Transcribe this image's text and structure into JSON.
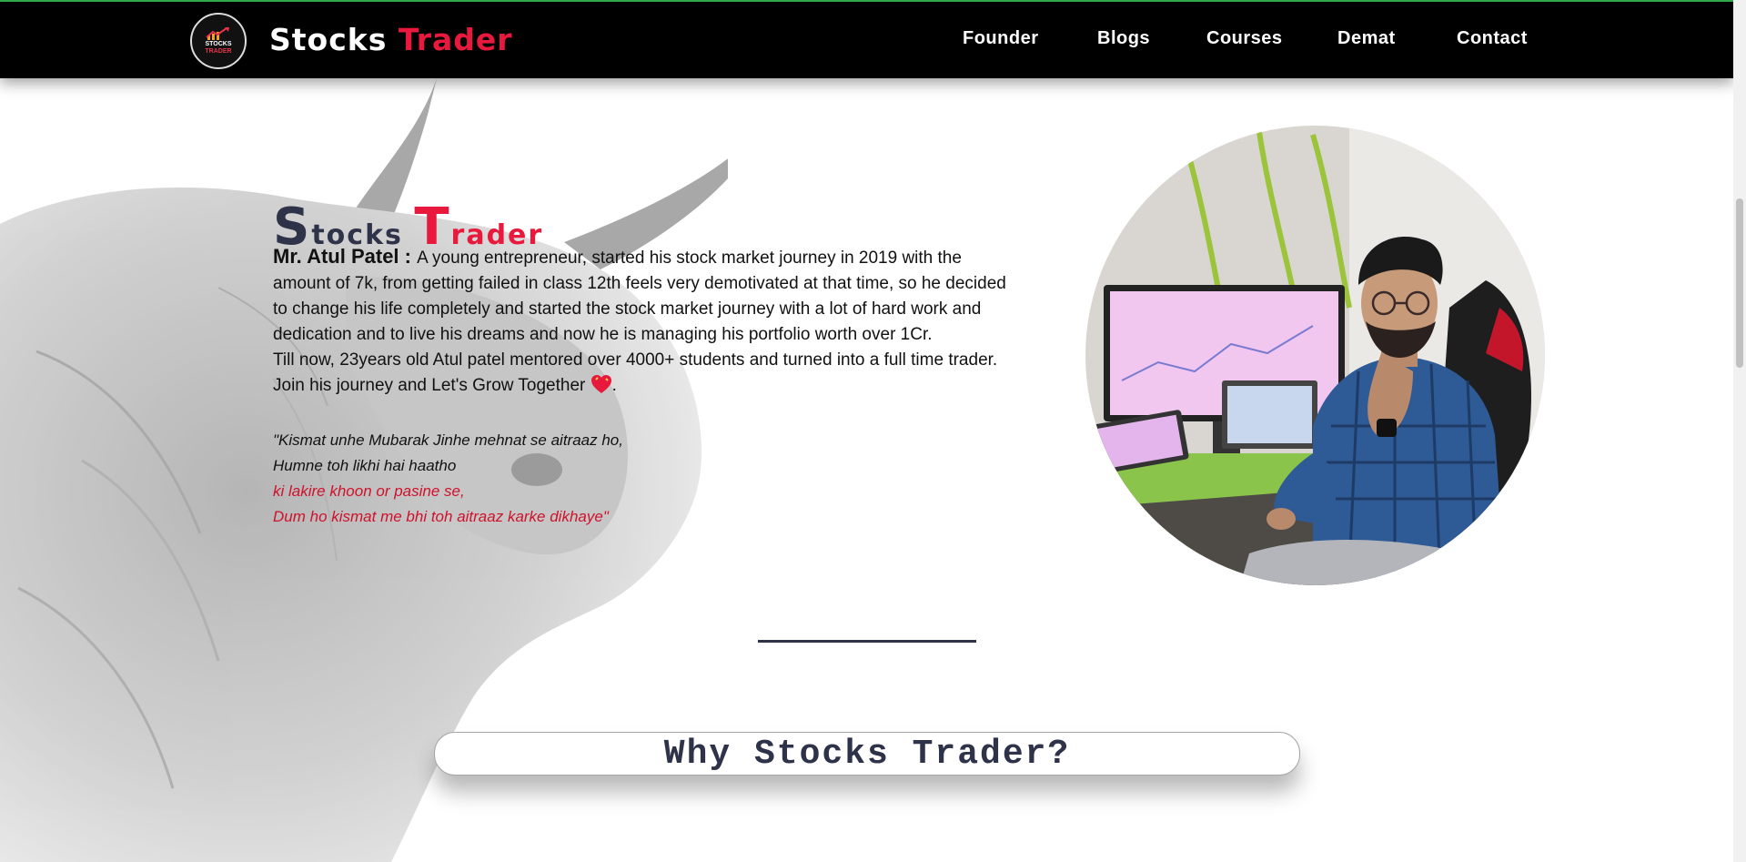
{
  "navbar": {
    "logo": {
      "line1": "STOCKS",
      "line2": "TRADER"
    },
    "brand": {
      "first_initial": "S",
      "first_rest": "tocks ",
      "second_initial": "T",
      "second_rest": "rader"
    },
    "links": [
      "Founder",
      "Blogs",
      "Courses",
      "Demat",
      "Contact"
    ]
  },
  "hero": {
    "title": {
      "first_initial": "S",
      "first_rest": "tocks ",
      "second_initial": "T",
      "second_rest": "rader"
    },
    "founder_label": "Mr. Atul Patel : ",
    "bio_line1": "A young entrepreneur, started his stock market journey in 2019 with the amount of 7k, from getting failed in class 12th feels very demotivated at that time, so he decided to change his life completely and started the stock market journey with a lot of hard work and dedication and to live his dreams and now he is managing his portfolio worth over 1Cr.",
    "bio_line2": "Till now, 23years old Atul patel mentored over 4000+ students and turned into a full time trader.",
    "bio_line3": "Join his journey and Let's Grow Together",
    "bio_line3_end": ".",
    "quote": [
      "\"Kismat unhe Mubarak Jinhe mehnat se aitraaz ho,",
      "Humne toh likhi hai haatho",
      "ki lakire khoon or pasine se,",
      "Dum ho kismat me bhi toh aitraaz karke dikhaye\""
    ]
  },
  "section": {
    "why_title": "Why Stocks Trader?"
  },
  "colors": {
    "navy": "#2f3349",
    "red": "#e8193d",
    "nav_bg": "#000000"
  },
  "icons": {
    "heart": "sparkling-heart-icon",
    "logo": "stocks-trader-logo"
  }
}
